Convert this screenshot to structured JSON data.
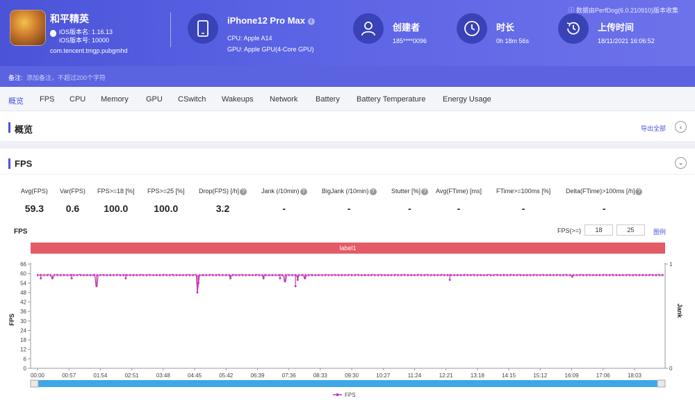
{
  "header": {
    "app_name": "和平精英",
    "ios_version_name": "iOS版本名: 1.16.13",
    "ios_version_code": "iOS版本号: 10000",
    "package": "com.tencent.tmgp.pubgmhd",
    "device_name": "iPhone12 Pro Max",
    "cpu": "CPU: Apple A14",
    "gpu": "GPU: Apple GPU(4-Core GPU)",
    "creator_label": "创建者",
    "creator_value": "185****0096",
    "duration_label": "时长",
    "duration_value": "0h 18m 56s",
    "upload_label": "上传时间",
    "upload_value": "18/11/2021 16:06:52",
    "notice": "ⓘ 数据由PerfDog(6.0.210910)版本收集"
  },
  "remark": {
    "label": "备注:",
    "placeholder": "添加备注，不超过200个字符"
  },
  "tabs": [
    "概览",
    "FPS",
    "CPU",
    "Memory",
    "GPU",
    "CSwitch",
    "Wakeups",
    "Network",
    "Battery",
    "Battery Temperature",
    "Energy Usage"
  ],
  "overview": {
    "title": "概览",
    "export_label": "导出全部",
    "collapse_icon": "‹"
  },
  "fps_section": {
    "title": "FPS",
    "expand_icon": "⌄",
    "stats": [
      {
        "label": "Avg(FPS)",
        "value": "59.3",
        "help": false
      },
      {
        "label": "Var(FPS)",
        "value": "0.6",
        "help": false
      },
      {
        "label": "FPS>=18 [%]",
        "value": "100.0",
        "help": false
      },
      {
        "label": "FPS>=25 [%]",
        "value": "100.0",
        "help": false
      },
      {
        "label": "Drop(FPS) [/h]",
        "value": "3.2",
        "help": true
      },
      {
        "label": "Jank (/10min)",
        "value": "-",
        "help": true
      },
      {
        "label": "BigJank (/10min)",
        "value": "-",
        "help": true
      },
      {
        "label": "Stutter [%]",
        "value": "-",
        "help": true
      },
      {
        "label": "Avg(FTime) [ms]",
        "value": "-",
        "help": false
      },
      {
        "label": "FTime>=100ms [%]",
        "value": "-",
        "help": false
      },
      {
        "label": "Delta(FTime)>100ms [/h]",
        "value": "-",
        "help": true
      }
    ],
    "chart_title": "FPS",
    "threshold_label": "FPS(>=)",
    "threshold_1": "18",
    "threshold_2": "25",
    "link_label": "图例",
    "label_bar": "label1",
    "help_icon": "?"
  },
  "chart_data": {
    "type": "line",
    "title": "FPS",
    "ylabel": "FPS",
    "y2label": "Jank",
    "ylim": [
      0,
      66
    ],
    "y_ticks": [
      0,
      6,
      12,
      18,
      24,
      30,
      36,
      42,
      48,
      54,
      60,
      66
    ],
    "y2_ticks": [
      0,
      1
    ],
    "x_ticks": [
      "00:00",
      "00:57",
      "01:54",
      "02:51",
      "03:48",
      "04:45",
      "05:42",
      "06:39",
      "07:36",
      "08:33",
      "09:30",
      "10:27",
      "11:24",
      "12:21",
      "13:18",
      "14:15",
      "15:12",
      "16:09",
      "17:06",
      "18:03"
    ],
    "series": [
      {
        "name": "FPS",
        "color": "#c13bb4",
        "baseline": 59,
        "dips": [
          {
            "time": "00:06",
            "value": 57
          },
          {
            "time": "00:27",
            "value": 57
          },
          {
            "time": "01:02",
            "value": 57
          },
          {
            "time": "01:47",
            "value": 52
          },
          {
            "time": "02:40",
            "value": 57
          },
          {
            "time": "04:50",
            "value": 48
          },
          {
            "time": "04:52",
            "value": 54
          },
          {
            "time": "05:50",
            "value": 57
          },
          {
            "time": "06:50",
            "value": 57
          },
          {
            "time": "07:20",
            "value": 57
          },
          {
            "time": "07:29",
            "value": 55
          },
          {
            "time": "07:48",
            "value": 52
          },
          {
            "time": "07:52",
            "value": 56
          },
          {
            "time": "08:05",
            "value": 57
          },
          {
            "time": "12:28",
            "value": 56
          },
          {
            "time": "16:10",
            "value": 58
          }
        ]
      }
    ],
    "legend": "bottom",
    "grid": false
  }
}
